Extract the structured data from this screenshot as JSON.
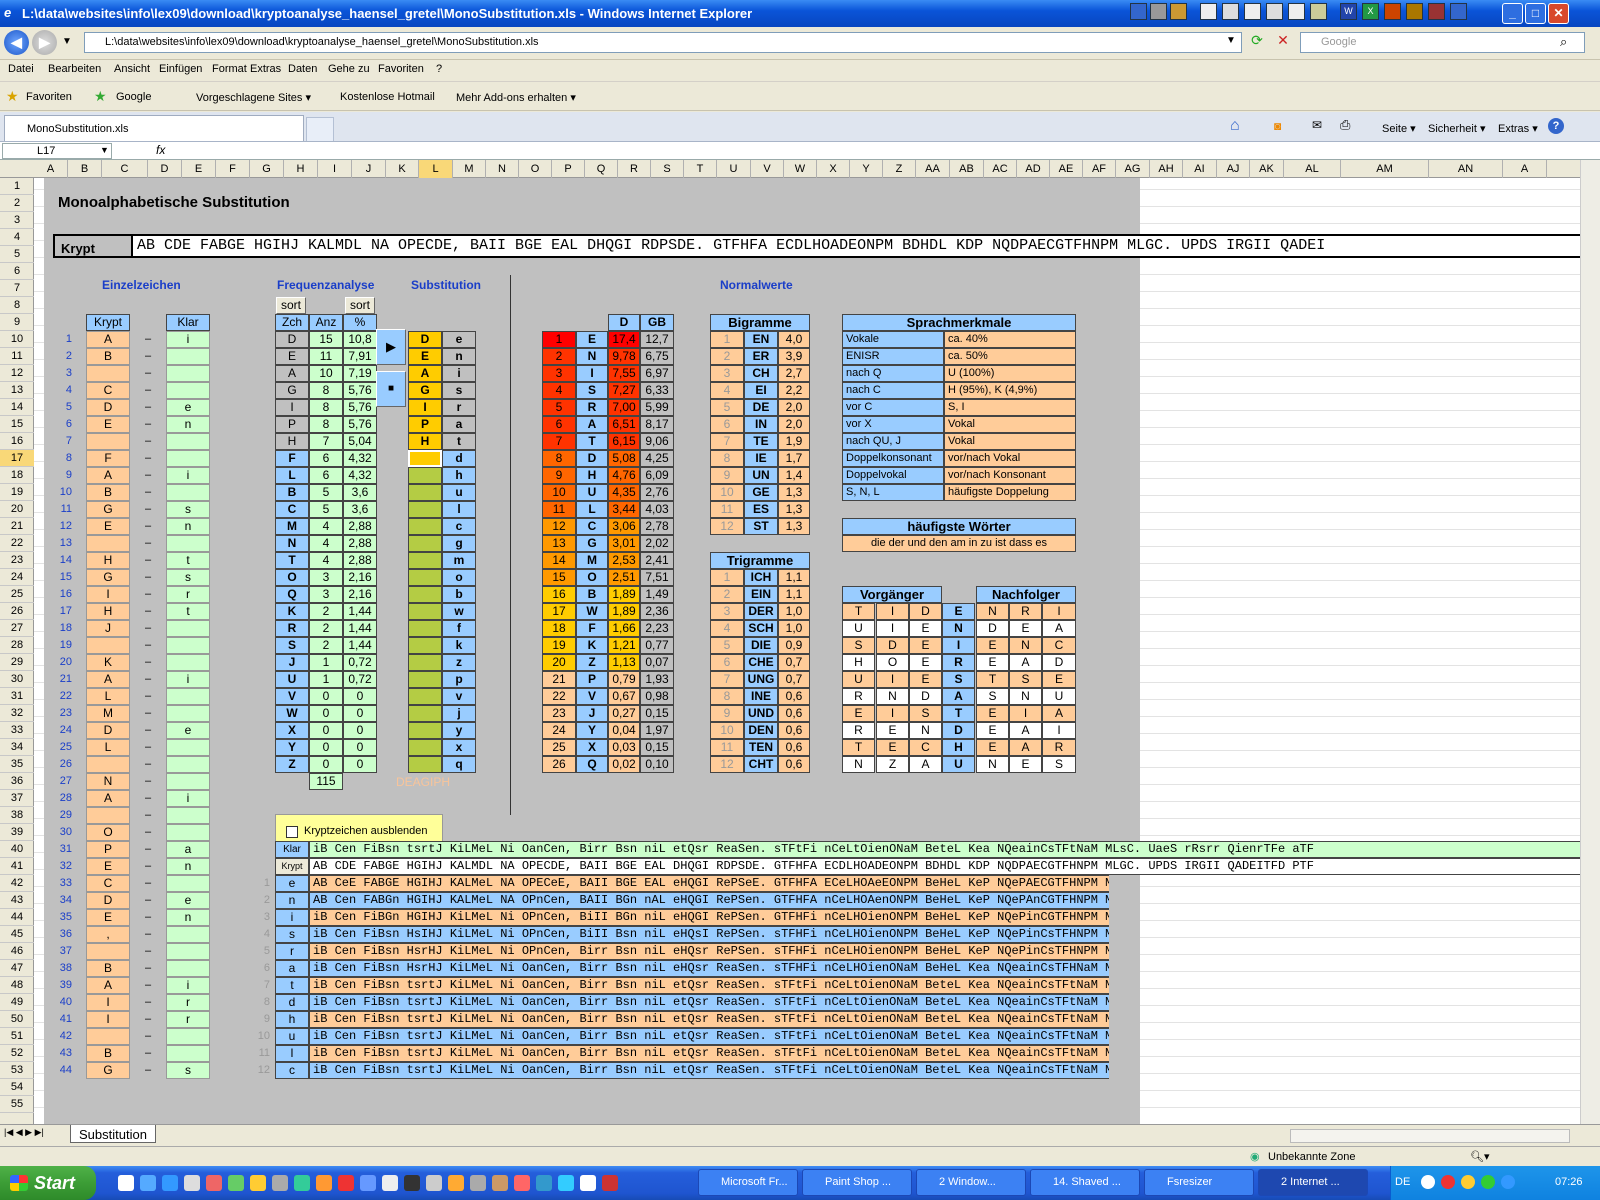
{
  "window": {
    "title": "L:\\data\\websites\\info\\lex09\\download\\kryptoanalyse_haensel_gretel\\MonoSubstitution.xls - Windows Internet Explorer"
  },
  "address": {
    "url": "L:\\data\\websites\\info\\lex09\\download\\kryptoanalyse_haensel_gretel\\MonoSubstitution.xls",
    "search_placeholder": "Google"
  },
  "menu": [
    "Datei",
    "Bearbeiten",
    "Ansicht",
    "Einfügen",
    "Format",
    "Extras",
    "Daten",
    "Gehe zu",
    "Favoriten",
    "?"
  ],
  "favorites": {
    "label": "Favoriten",
    "items": [
      "Google",
      "Vorgeschlagene Sites ▾",
      "Kostenlose Hotmail",
      "Mehr Add-ons erhalten ▾"
    ]
  },
  "tab": {
    "label": "MonoSubstitution.xls"
  },
  "tabtools": [
    "Seite ▾",
    "Sicherheit ▾",
    "Extras ▾"
  ],
  "formula": {
    "namebox": "L17",
    "fx": "fx"
  },
  "columns": [
    "A",
    "B",
    "C",
    "D",
    "E",
    "F",
    "G",
    "H",
    "I",
    "J",
    "K",
    "L",
    "M",
    "N",
    "O",
    "P",
    "Q",
    "R",
    "S",
    "T",
    "U",
    "V",
    "W",
    "X",
    "Y",
    "Z",
    "AA",
    "AB",
    "AC",
    "AD",
    "AE",
    "AF",
    "AG",
    "AH",
    "AI",
    "AJ",
    "AK",
    "AL",
    "AM",
    "AN",
    "A"
  ],
  "sheet": {
    "title": "Monoalphabetische Substitution",
    "krypt_label": "Krypt",
    "krypt_text": "AB CDE FABGE HGIHJ KALMDL NA OPECDE, BAII BGE EAL DHQGI RDPSDE. GTFHFA ECDLHOADEONPM BDHDL KDP NQDPAECGTFHNPM MLGC. UPDS IRGII QADEI",
    "sections": {
      "einzel": "Einzelzeichen",
      "freq": "Frequenzanalyse",
      "subst": "Substitution",
      "normal": "Normalwerte"
    },
    "einzel": {
      "head_krypt": "Krypt",
      "head_klar": "Klar",
      "krypt": [
        "A",
        "B",
        "",
        "C",
        "D",
        "E",
        "",
        "F",
        "A",
        "B",
        "G",
        "E",
        "",
        "H",
        "G",
        "I",
        "H",
        "J",
        "",
        "K",
        "A",
        "L",
        "M",
        "D",
        "L",
        "",
        "N",
        "A",
        "",
        "O",
        "P",
        "E",
        "C",
        "D",
        "E",
        ",",
        "",
        "B",
        "A",
        "I",
        "I",
        "",
        "B",
        "G"
      ],
      "klar": [
        "i",
        "",
        "",
        "",
        "e",
        "n",
        "",
        "",
        "i",
        "",
        "s",
        "n",
        "",
        "t",
        "s",
        "r",
        "t",
        "",
        "",
        "",
        "i",
        "",
        "",
        "e",
        "",
        "",
        "",
        "i",
        "",
        "",
        "a",
        "n",
        "",
        "e",
        "n",
        "",
        "",
        "",
        "i",
        "r",
        "r",
        "",
        "",
        "s"
      ]
    },
    "freq": {
      "sort": "sort",
      "head_zch": "Zch",
      "head_anz": "Anz",
      "head_pct": "%",
      "zch": [
        "D",
        "E",
        "A",
        "G",
        "I",
        "P",
        "H",
        "F",
        "L",
        "B",
        "C",
        "M",
        "N",
        "T",
        "O",
        "Q",
        "K",
        "R",
        "S",
        "J",
        "U",
        "V",
        "W",
        "X",
        "Y",
        "Z"
      ],
      "anz": [
        "15",
        "11",
        "10",
        "8",
        "8",
        "8",
        "7",
        "6",
        "6",
        "5",
        "5",
        "4",
        "4",
        "4",
        "3",
        "3",
        "2",
        "2",
        "2",
        "1",
        "1",
        "0",
        "0",
        "0",
        "0",
        "0"
      ],
      "pct": [
        "10,8",
        "7,91",
        "7,19",
        "5,76",
        "5,76",
        "5,76",
        "5,04",
        "4,32",
        "4,32",
        "3,6",
        "3,6",
        "2,88",
        "2,88",
        "2,88",
        "2,16",
        "2,16",
        "1,44",
        "1,44",
        "1,44",
        "0,72",
        "0,72",
        "0",
        "0",
        "0",
        "0",
        "0"
      ],
      "total": "115"
    },
    "subst": {
      "play": "▶",
      "stop": "■",
      "left": [
        "D",
        "E",
        "A",
        "G",
        "I",
        "P",
        "H"
      ],
      "right": [
        "e",
        "n",
        "i",
        "s",
        "r",
        "a",
        "t",
        "d",
        "h",
        "u",
        "l",
        "c",
        "g",
        "m",
        "o",
        "b",
        "w",
        "f",
        "k",
        "z",
        "p",
        "v",
        "j",
        "y",
        "x",
        "q"
      ],
      "faded": "DEAGIPH"
    },
    "normal": {
      "head_d": "D",
      "head_gb": "GB",
      "nr": [
        "1",
        "2",
        "3",
        "4",
        "5",
        "6",
        "7",
        "8",
        "9",
        "10",
        "11",
        "12",
        "13",
        "14",
        "15",
        "16",
        "17",
        "18",
        "19",
        "20",
        "21",
        "22",
        "23",
        "24",
        "25",
        "26"
      ],
      "letter": [
        "E",
        "N",
        "I",
        "S",
        "R",
        "A",
        "T",
        "D",
        "H",
        "U",
        "L",
        "C",
        "G",
        "M",
        "O",
        "B",
        "W",
        "F",
        "K",
        "Z",
        "P",
        "V",
        "J",
        "Y",
        "X",
        "Q"
      ],
      "d": [
        "17,4",
        "9,78",
        "7,55",
        "7,27",
        "7,00",
        "6,51",
        "6,15",
        "5,08",
        "4,76",
        "4,35",
        "3,44",
        "3,06",
        "3,01",
        "2,53",
        "2,51",
        "1,89",
        "1,89",
        "1,66",
        "1,21",
        "1,13",
        "0,79",
        "0,67",
        "0,27",
        "0,04",
        "0,03",
        "0,02"
      ],
      "gb": [
        "12,7",
        "6,75",
        "6,97",
        "6,33",
        "5,99",
        "8,17",
        "9,06",
        "4,25",
        "6,09",
        "2,76",
        "4,03",
        "2,78",
        "2,02",
        "2,41",
        "7,51",
        "1,49",
        "2,36",
        "2,23",
        "0,77",
        "0,07",
        "1,93",
        "0,98",
        "0,15",
        "1,97",
        "0,15",
        "0,10"
      ],
      "nrcolors": [
        "#ff0000",
        "#ff3300",
        "#ff3300",
        "#ff3300",
        "#ff3300",
        "#ff3300",
        "#ff3300",
        "#ff6600",
        "#ff6600",
        "#ff6600",
        "#ff6600",
        "#ff9900",
        "#ff9900",
        "#ff9900",
        "#ff9900",
        "#ffcc00",
        "#ffcc00",
        "#ffcc00",
        "#ffcc00",
        "#ffcc00",
        "#ffcc99",
        "#ffcc99",
        "#ffcc99",
        "#ffcc99",
        "#ffcc99",
        "#ffcc99"
      ]
    },
    "bigramme": {
      "title": "Bigramme",
      "items": [
        [
          "1",
          "EN",
          "4,0"
        ],
        [
          "2",
          "ER",
          "3,9"
        ],
        [
          "3",
          "CH",
          "2,7"
        ],
        [
          "4",
          "EI",
          "2,2"
        ],
        [
          "5",
          "DE",
          "2,0"
        ],
        [
          "6",
          "IN",
          "2,0"
        ],
        [
          "7",
          "TE",
          "1,9"
        ],
        [
          "8",
          "IE",
          "1,7"
        ],
        [
          "9",
          "UN",
          "1,4"
        ],
        [
          "10",
          "GE",
          "1,3"
        ],
        [
          "11",
          "ES",
          "1,3"
        ],
        [
          "12",
          "ST",
          "1,3"
        ]
      ]
    },
    "trigramme": {
      "title": "Trigramme",
      "items": [
        [
          "1",
          "ICH",
          "1,1"
        ],
        [
          "2",
          "EIN",
          "1,1"
        ],
        [
          "3",
          "DER",
          "1,0"
        ],
        [
          "4",
          "SCH",
          "1,0"
        ],
        [
          "5",
          "DIE",
          "0,9"
        ],
        [
          "6",
          "CHE",
          "0,7"
        ],
        [
          "7",
          "UNG",
          "0,7"
        ],
        [
          "8",
          "INE",
          "0,6"
        ],
        [
          "9",
          "UND",
          "0,6"
        ],
        [
          "10",
          "DEN",
          "0,6"
        ],
        [
          "11",
          "TEN",
          "0,6"
        ],
        [
          "12",
          "CHT",
          "0,6"
        ]
      ]
    },
    "sprach": {
      "title": "Sprachmerkmale",
      "items": [
        [
          "Vokale",
          "ca. 40%"
        ],
        [
          "ENISR",
          "ca. 50%"
        ],
        [
          "nach Q",
          "U (100%)"
        ],
        [
          "nach C",
          "H (95%), K (4,9%)"
        ],
        [
          "vor C",
          "S, I"
        ],
        [
          "vor X",
          "Vokal"
        ],
        [
          "nach QU, J",
          "Vokal"
        ],
        [
          "Doppelkonsonant",
          "vor/nach Vokal"
        ],
        [
          "Doppelvokal",
          "vor/nach Konsonant"
        ],
        [
          "S, N, L",
          "häufigste Doppelung"
        ]
      ]
    },
    "woerter": {
      "title": "häufigste Wörter",
      "text": "die der und den am in zu ist dass es"
    },
    "vn": {
      "vor": "Vorgänger",
      "nach": "Nachfolger",
      "rows": [
        [
          "T",
          "I",
          "D",
          "E",
          "N",
          "R",
          "I"
        ],
        [
          "U",
          "I",
          "E",
          "N",
          "D",
          "E",
          "A"
        ],
        [
          "S",
          "D",
          "E",
          "I",
          "E",
          "N",
          "C"
        ],
        [
          "H",
          "O",
          "E",
          "R",
          "E",
          "A",
          "D"
        ],
        [
          "U",
          "I",
          "E",
          "S",
          "T",
          "S",
          "E"
        ],
        [
          "R",
          "N",
          "D",
          "A",
          "S",
          "N",
          "U"
        ],
        [
          "E",
          "I",
          "S",
          "T",
          "E",
          "I",
          "A"
        ],
        [
          "R",
          "E",
          "N",
          "D",
          "E",
          "A",
          "I"
        ],
        [
          "T",
          "E",
          "C",
          "H",
          "E",
          "A",
          "R"
        ],
        [
          "N",
          "Z",
          "A",
          "U",
          "N",
          "E",
          "S"
        ]
      ]
    },
    "checkbox": "Kryptzeichen ausblenden",
    "klar_label": "Klar",
    "krypt2_label": "Krypt",
    "klar_line": "iB Cen FiBsn tsrtJ KiLMeL Ni OanCen, Birr Bsn niL etQsr ReaSen. sTFtFi nCeLtOienONaM BeteL Kea NQeainCsTFtNaM MLsC. UaeS rRsrr QienrTFe aTF",
    "krypt_line2": "AB CDE FABGE HGIHJ KALMDL NA OPECDE, BAII BGE EAL DHQGI RDPSDE. GTFHFA ECDLHOADEONPM BDHDL KDP NQDPAECGTFHNPM MLGC. UPDS IRGII QADEITFD PTF",
    "steps": [
      {
        "n": "1",
        "c": "e",
        "t": "AB CeE FABGE HGIHJ KALMeL NA OPECeE, BAII BGE EAL eHQGI RePSeE. GTFHFA ECeLHOAeEONPM BeHeL KeP NQePAECGTFHNPM MLGC. UPeS IRGII QAeEITFe PTF"
      },
      {
        "n": "2",
        "c": "n",
        "t": "AB Cen FABGn HGIHJ KALMeL NA OPnCen, BAII BGn nAL eHQGI RePSen. GTFHFA nCeLHOAenONPM BeHeL KeP NQePAnCGTFHNPM MLGC. UPeS IRGII QAenITFe PTF"
      },
      {
        "n": "3",
        "c": "i",
        "t": "iB Cen FiBGn HGIHJ KiLMeL Ni OPnCen, BiII BGn niL eHQGI RePSen. GTFHFi nCeLHOienONPM BeHeL KeP NQePinCGTFHNPM MLGC. UPeS IRGII QienITFe PTF"
      },
      {
        "n": "4",
        "c": "s",
        "t": "iB Cen FiBsn HsIHJ KiLMeL Ni OPnCen, BiII Bsn niL eHQsI RePSen. sTFHFi nCeLHOienONPM BeHeL KeP NQePinCsTFHNPM MLsC. UPeS IRsII QienITFe PTF"
      },
      {
        "n": "5",
        "c": "r",
        "t": "iB Cen FiBsn HsrHJ KiLMeL Ni OPnCen, Birr Bsn niL eHQsr RePSen. sTFHFi nCeLHOienONPM BeHeL KeP NQePinCsTFHNPM MLsC. UPeS rRsrr QienrTFe PTF"
      },
      {
        "n": "6",
        "c": "a",
        "t": "iB Cen FiBsn HsrHJ KiLMeL Ni OanCen, Birr Bsn niL eHQsr ReaSen. sTFHFi nCeLHOienONaM BeHeL Kea NQeainCsTFHNaM MLsC. UaeS rRsrr QienrTFe aTF"
      },
      {
        "n": "7",
        "c": "t",
        "t": "iB Cen FiBsn tsrtJ KiLMeL Ni OanCen, Birr Bsn niL etQsr ReaSen. sTFtFi nCeLtOienONaM BeteL Kea NQeainCsTFtNaM MLsC. UaeS rRsrr QienrTFe aTF"
      },
      {
        "n": "8",
        "c": "d",
        "t": "iB Cen FiBsn tsrtJ KiLMeL Ni OanCen, Birr Bsn niL etQsr ReaSen. sTFtFi nCeLtOienONaM BeteL Kea NQeainCsTFtNaM MLsC. UaeS rRsrr QienrTFe aTF"
      },
      {
        "n": "9",
        "c": "h",
        "t": "iB Cen FiBsn tsrtJ KiLMeL Ni OanCen, Birr Bsn niL etQsr ReaSen. sTFtFi nCeLtOienONaM BeteL Kea NQeainCsTFtNaM MLsC. UaeS rRsrr QienrTFe aTF"
      },
      {
        "n": "10",
        "c": "u",
        "t": "iB Cen FiBsn tsrtJ KiLMeL Ni OanCen, Birr Bsn niL etQsr ReaSen. sTFtFi nCeLtOienONaM BeteL Kea NQeainCsTFtNaM MLsC. UaeS rRsrr QienrTFe aTF"
      },
      {
        "n": "11",
        "c": "l",
        "t": "iB Cen FiBsn tsrtJ KiLMeL Ni OanCen, Birr Bsn niL etQsr ReaSen. sTFtFi nCeLtOienONaM BeteL Kea NQeainCsTFtNaM MLsC. UaeS rRsrr QienrTFe aTF"
      },
      {
        "n": "12",
        "c": "c",
        "t": "iB Cen FiBsn tsrtJ KiLMeL Ni OanCen, Birr Bsn niL etQsr ReaSen. sTFtFi nCeLtOienONaM BeteL Kea NQeainCsTFtNaM MLsC. UaeS rRsrr QienrTFe aTF"
      }
    ]
  },
  "sheettab": "Substitution",
  "status": {
    "zone": "Unbekannte Zone"
  },
  "taskbar": {
    "start": "Start",
    "tasks": [
      "Microsoft Fr...",
      "Paint Shop ...",
      "2 Window...",
      "14. Shaved ...",
      "Fsresizer",
      "2 Internet ..."
    ],
    "lang": "DE",
    "clock": "07:26"
  }
}
